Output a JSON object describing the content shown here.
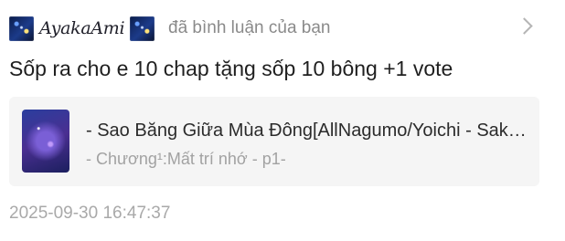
{
  "header": {
    "username": "AyakaAmi",
    "action_text": "đã bình luận của bạn",
    "chevron_icon": "chevron-right-icon"
  },
  "comment": {
    "text": "Sốp ra cho e 10 chap tặng sốp 10 bông +1 vote"
  },
  "reference": {
    "title": "- Sao Băng Giữa Mùa Đông[AllNagumo/Yoichi - Sakamoto Days]",
    "subtitle": "- Chương¹:Mất trí nhớ - p1-"
  },
  "timestamp": "2025-09-30 16:47:37"
}
